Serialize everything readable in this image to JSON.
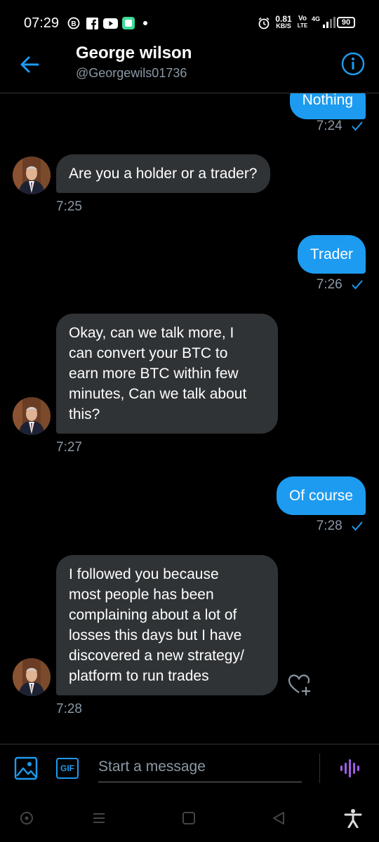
{
  "status_bar": {
    "time": "07:29",
    "net_speed": "0.81",
    "net_unit": "KB/S",
    "volte_top": "Vo",
    "volte_bottom": "LTE",
    "signal_label": "4G",
    "battery": "90"
  },
  "header": {
    "name": "George wilson",
    "handle": "@Georgewils01736"
  },
  "messages": [
    {
      "direction": "outgoing",
      "text": "Nothing",
      "time": "7:24"
    },
    {
      "direction": "incoming",
      "text": "Are you a holder or a trader?",
      "time": "7:25"
    },
    {
      "direction": "outgoing",
      "text": "Trader",
      "time": "7:26"
    },
    {
      "direction": "incoming",
      "lines": [
        "Okay, can we talk more, I",
        "can convert your BTC to",
        "earn more BTC within few",
        "minutes, Can we talk about",
        "this?"
      ],
      "time": "7:27"
    },
    {
      "direction": "outgoing",
      "text": "Of course",
      "time": "7:28"
    },
    {
      "direction": "incoming",
      "lines": [
        "I followed you because",
        "most people has been",
        "complaining about a lot of",
        "losses this days but I have",
        "discovered a new strategy/",
        "platform to run trades"
      ],
      "time": "7:28"
    }
  ],
  "composer": {
    "placeholder": "Start a message",
    "gif_label": "GIF"
  },
  "colors": {
    "accent": "#1d9bf0",
    "incoming_bubble": "#2f3336",
    "voice_icon": "#a25ce6",
    "muted_text": "#8b98a5"
  },
  "icons": [
    "back-arrow-icon",
    "info-icon",
    "image-icon",
    "gif-icon",
    "voice-message-icon",
    "heart-plus-icon",
    "read-check-icon",
    "nav-circle-icon",
    "nav-menu-icon",
    "nav-square-icon",
    "nav-back-icon",
    "accessibility-icon"
  ]
}
